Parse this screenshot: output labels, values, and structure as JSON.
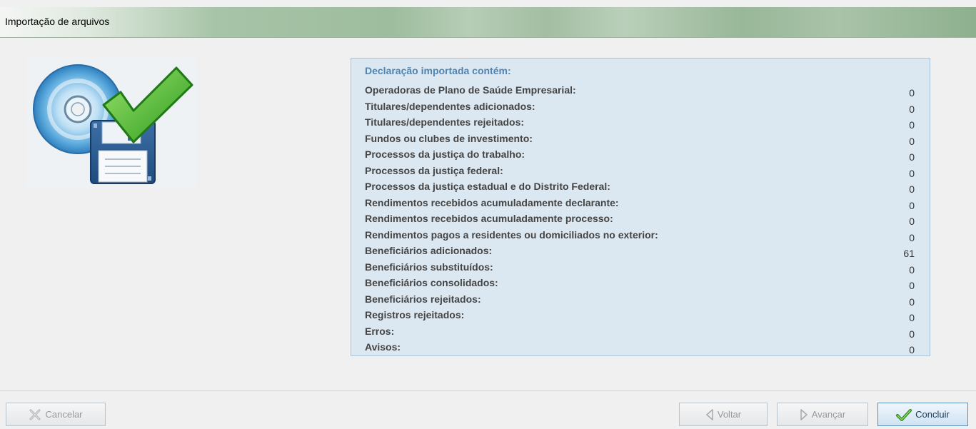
{
  "window": {
    "title": "Importação de arquivos"
  },
  "summary": {
    "header": "Declaração importada contém:",
    "rows": [
      {
        "label": "Operadoras de Plano de Saúde Empresarial:",
        "value": "0"
      },
      {
        "label": "Titulares/dependentes adicionados:",
        "value": "0"
      },
      {
        "label": "Titulares/dependentes rejeitados:",
        "value": "0"
      },
      {
        "label": "Fundos ou clubes de investimento:",
        "value": "0"
      },
      {
        "label": "Processos da justiça do trabalho:",
        "value": "0"
      },
      {
        "label": "Processos da justiça federal:",
        "value": "0"
      },
      {
        "label": "Processos da justiça estadual e do Distrito Federal:",
        "value": "0"
      },
      {
        "label": "Rendimentos recebidos acumuladamente declarante:",
        "value": "0"
      },
      {
        "label": "Rendimentos recebidos acumuladamente processo:",
        "value": "0"
      },
      {
        "label": "Rendimentos pagos a residentes ou domiciliados no exterior:",
        "value": "0"
      },
      {
        "label": "Beneficiários adicionados:",
        "value": "61"
      },
      {
        "label": "Beneficiários substituídos:",
        "value": "0"
      },
      {
        "label": "Beneficiários consolidados:",
        "value": "0"
      },
      {
        "label": "Beneficiários rejeitados:",
        "value": "0"
      },
      {
        "label": "Registros rejeitados:",
        "value": "0"
      },
      {
        "label": "Erros:",
        "value": "0"
      },
      {
        "label": "Avisos:",
        "value": "0"
      }
    ]
  },
  "buttons": {
    "cancel": "Cancelar",
    "back": "Voltar",
    "next": "Avançar",
    "finish": "Concluir"
  },
  "icons": {
    "illustration": "cd-floppy-checkmark-icon",
    "cancel": "x-icon",
    "back": "left-arrow-icon",
    "next": "right-arrow-icon",
    "finish": "checkmark-icon"
  },
  "colors": {
    "header_text": "#4f83b1",
    "panel_bg": "#dce8f1",
    "title_bar": "#9ebc9e",
    "check_green": "#3fae2a"
  }
}
